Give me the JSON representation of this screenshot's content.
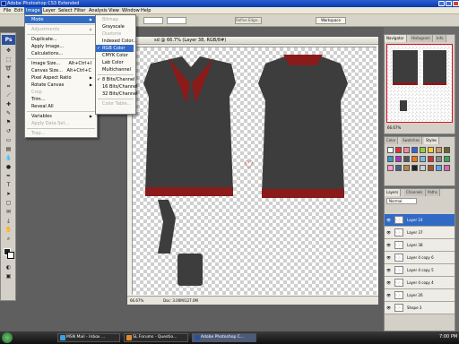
{
  "window": {
    "title": "Adobe Photoshop CS3 Extended"
  },
  "menubar": [
    "File",
    "Edit",
    "Image",
    "Layer",
    "Select",
    "Filter",
    "Analysis",
    "View",
    "Window",
    "Help"
  ],
  "options_bar": {
    "refine_edge": "Refine Edge...",
    "workspace": "Workspace"
  },
  "image_menu": [
    {
      "label": "Mode",
      "submenu": true,
      "selected": true
    },
    {
      "sep": true
    },
    {
      "label": "Adjustments",
      "submenu": true,
      "disabled": true
    },
    {
      "sep": true
    },
    {
      "label": "Duplicate..."
    },
    {
      "label": "Apply Image..."
    },
    {
      "label": "Calculations..."
    },
    {
      "sep": true
    },
    {
      "label": "Image Size...",
      "shortcut": "Alt+Ctrl+I"
    },
    {
      "label": "Canvas Size...",
      "shortcut": "Alt+Ctrl+C"
    },
    {
      "label": "Pixel Aspect Ratio",
      "submenu": true
    },
    {
      "label": "Rotate Canvas",
      "submenu": true
    },
    {
      "label": "Crop",
      "disabled": true
    },
    {
      "label": "Trim..."
    },
    {
      "label": "Reveal All"
    },
    {
      "sep": true
    },
    {
      "label": "Variables",
      "submenu": true
    },
    {
      "label": "Apply Data Set...",
      "disabled": true
    },
    {
      "sep": true
    },
    {
      "label": "Trap...",
      "disabled": true
    }
  ],
  "mode_submenu": [
    {
      "label": "Bitmap",
      "disabled": true
    },
    {
      "label": "Grayscale"
    },
    {
      "label": "Duotone",
      "disabled": true
    },
    {
      "label": "Indexed Color..."
    },
    {
      "label": "RGB Color",
      "checked": true,
      "selected": true
    },
    {
      "label": "CMYK Color"
    },
    {
      "label": "Lab Color"
    },
    {
      "label": "Multichannel"
    },
    {
      "sep": true
    },
    {
      "label": "8 Bits/Channel",
      "checked": true
    },
    {
      "label": "16 Bits/Channel"
    },
    {
      "label": "32 Bits/Channel"
    },
    {
      "sep": true
    },
    {
      "label": "Color Table...",
      "disabled": true
    }
  ],
  "document": {
    "title": "sd @ 66.7% (Layer 38, RGB/8#)",
    "zoom": "66.67%",
    "doc_info": "Doc: 3.00M/127.0M"
  },
  "navigator": {
    "tabs": [
      "Navigator",
      "Histogram",
      "Info"
    ],
    "zoom": "66.67%"
  },
  "color_panel": {
    "tabs": [
      "Color",
      "Swatches",
      "Styles"
    ]
  },
  "layers_panel": {
    "tabs": [
      "Layers",
      "Channels",
      "Paths"
    ],
    "blend": "Normal",
    "items": [
      {
        "name": "Layer 24",
        "active": true
      },
      {
        "name": "Layer 37"
      },
      {
        "name": "Layer 38"
      },
      {
        "name": "Layer 4 copy 6"
      },
      {
        "name": "Layer 4 copy 5"
      },
      {
        "name": "Layer 4 copy 4"
      },
      {
        "name": "Layer 26"
      },
      {
        "name": "Shape 3"
      }
    ]
  },
  "taskbar": {
    "tasks": [
      "MSN Mail - Inbox ...",
      "SL Forums - Questio...",
      "Adobe Photoshop C..."
    ],
    "clock": "7:00 PM"
  },
  "colors": {
    "shirt": "#3d3d3d",
    "collar": "#8b1a1a",
    "accent": "#316ac5"
  }
}
